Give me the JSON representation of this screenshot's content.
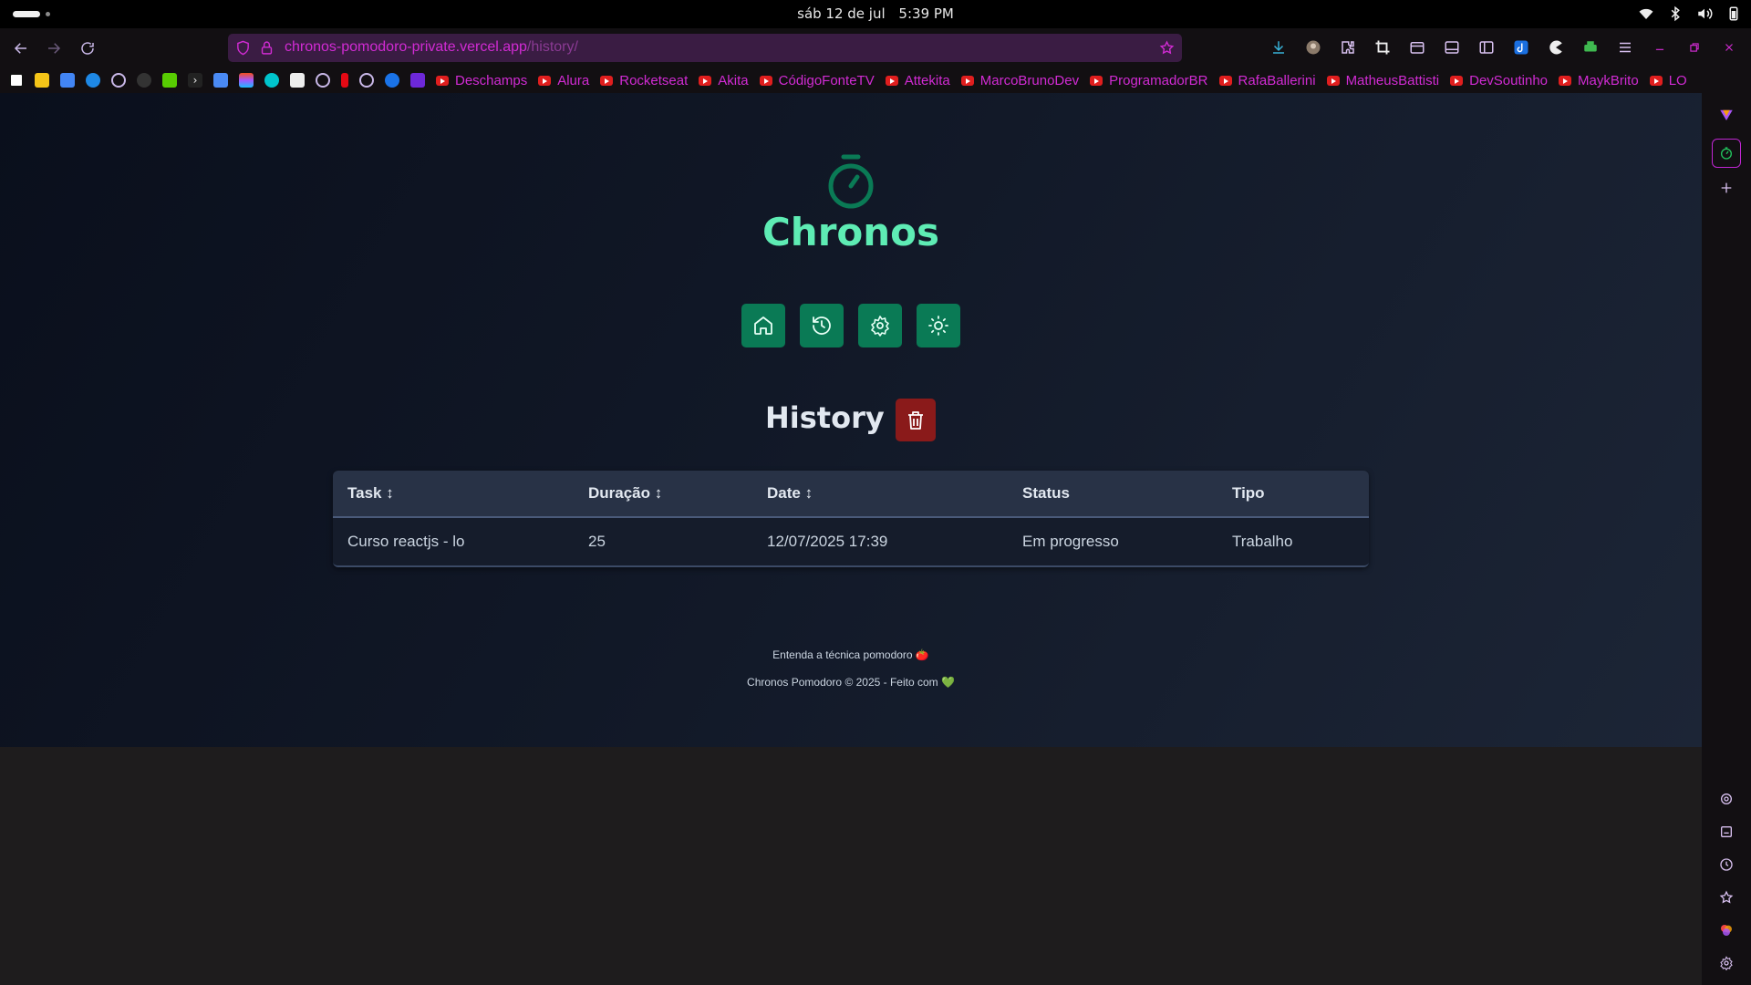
{
  "os": {
    "date": "sáb 12 de jul",
    "time": "5:39 PM"
  },
  "browser": {
    "url_host": "chronos-pomodoro-private.vercel.app",
    "url_path": "/history/",
    "bookmarks": [
      "Deschamps",
      "Alura",
      "Rocketseat",
      "Akita",
      "CódigoFonteTV",
      "Attekita",
      "MarcoBrunoDev",
      "ProgramadorBR",
      "RafaBallerini",
      "MatheusBattisti",
      "DevSoutinho",
      "MaykBrito",
      "LO"
    ]
  },
  "app": {
    "brand": "Chronos",
    "menu": [
      {
        "icon": "home-icon"
      },
      {
        "icon": "history-icon"
      },
      {
        "icon": "settings-icon"
      },
      {
        "icon": "sun-icon"
      }
    ],
    "page_title": "History",
    "table": {
      "headers": [
        "Task ↕",
        "Duração ↕",
        "Date ↕",
        "Status",
        "Tipo"
      ],
      "rows": [
        [
          "Curso reactjs - lo",
          "25",
          "12/07/2025 17:39",
          "Em progresso",
          "Trabalho"
        ]
      ]
    },
    "footer": {
      "link": "Entenda a técnica pomodoro 🍅",
      "copyright": "Chronos Pomodoro © 2025 - Feito com 💚"
    }
  },
  "colors": {
    "accent": "#0a7a55",
    "brand_text": "#5eecb4",
    "danger": "#8a1a1a",
    "url_text": "#d12bd3"
  }
}
